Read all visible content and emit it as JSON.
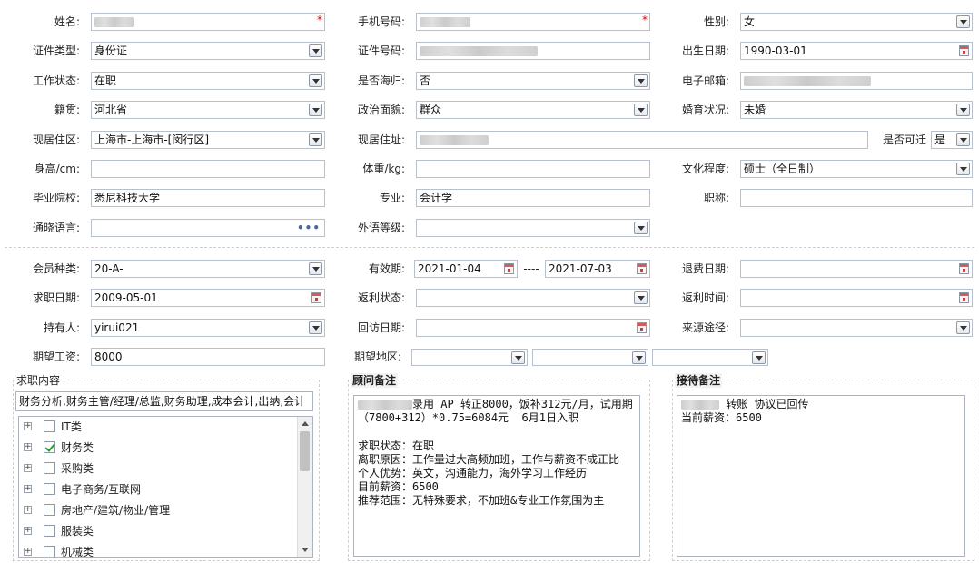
{
  "basic": {
    "name_label": "姓名:",
    "mobile_label": "手机号码:",
    "gender_label": "性别:",
    "gender_value": "女",
    "id_type_label": "证件类型:",
    "id_type_value": "身份证",
    "id_number_label": "证件号码:",
    "birth_label": "出生日期:",
    "birth_value": "1990-03-01",
    "work_status_label": "工作状态:",
    "work_status_value": "在职",
    "returnee_label": "是否海归:",
    "returnee_value": "否",
    "email_label": "电子邮箱:",
    "native_label": "籍贯:",
    "native_value": "河北省",
    "political_label": "政治面貌:",
    "political_value": "群众",
    "marital_label": "婚育状况:",
    "marital_value": "未婚",
    "residence_area_label": "现居住区:",
    "residence_area_value": "上海市-上海市-[闵行区]",
    "residence_addr_label": "现居住址:",
    "relocate_label": "是否可迁",
    "relocate_value": "是",
    "height_label": "身高/cm:",
    "weight_label": "体重/kg:",
    "education_label": "文化程度:",
    "education_value": "硕士（全日制）",
    "school_label": "毕业院校:",
    "school_value": "悉尼科技大学",
    "major_label": "专业:",
    "major_value": "会计学",
    "title_label": "职称:",
    "language_label": "通晓语言:",
    "foreign_level_label": "外语等级:"
  },
  "member": {
    "type_label": "会员种类:",
    "type_value": "20-A-",
    "validity_label": "有效期:",
    "validity_start": "2021-01-04",
    "validity_sep": "----",
    "validity_end": "2021-07-03",
    "refund_date_label": "退费日期:",
    "job_date_label": "求职日期:",
    "job_date_value": "2009-05-01",
    "rebate_status_label": "返利状态:",
    "rebate_time_label": "返利时间:",
    "holder_label": "持有人:",
    "holder_value": "yirui021",
    "visit_date_label": "回访日期:",
    "source_label": "来源途径:",
    "salary_label": "期望工资:",
    "salary_value": "8000",
    "region_label": "期望地区:"
  },
  "job_content": {
    "title": "求职内容",
    "summary": "财务分析,财务主管/经理/总监,财务助理,成本会计,出纳,会计",
    "categories": [
      {
        "label": "IT类",
        "checked": false
      },
      {
        "label": "财务类",
        "checked": true
      },
      {
        "label": "采购类",
        "checked": false
      },
      {
        "label": "电子商务/互联网",
        "checked": false
      },
      {
        "label": "房地产/建筑/物业/管理",
        "checked": false
      },
      {
        "label": "服装类",
        "checked": false
      },
      {
        "label": "机械类",
        "checked": false
      }
    ]
  },
  "consultant_notes": {
    "title": "顾问备注",
    "text": "录用 AP 转正8000，饭补312元/月，试用期（7800+312）*0.75=6084元  6月1日入职\n\n求职状态：在职\n离职原因：工作量过大高频加班，工作与薪资不成正比\n个人优势：英文，沟通能力，海外学习工作经历\n目前薪资：6500\n推荐范围：无特殊要求，不加班&专业工作氛围为主"
  },
  "reception_notes": {
    "title": "接待备注",
    "text": "转账 协议已回传\n当前薪资：6500"
  },
  "icons": [
    "dropdown-arrow-icon",
    "calendar-icon",
    "ellipsis-icon",
    "expand-plus-icon",
    "checkbox-icon"
  ],
  "colors": {
    "required": "#e00000",
    "border": "#b7c0cb"
  }
}
